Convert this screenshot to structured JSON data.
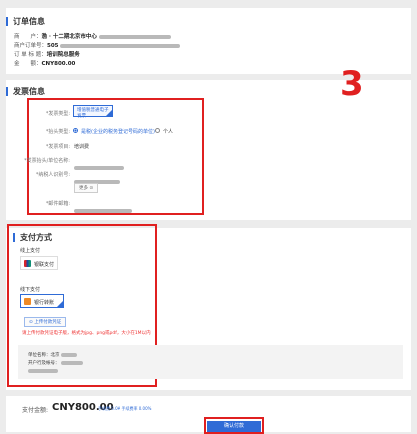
{
  "order": {
    "title": "订单信息",
    "rows": [
      {
        "label": "商　　户：",
        "value": "渤 · 十二期北京市中心"
      },
      {
        "label": "商户订单号：",
        "value": "505"
      },
      {
        "label": "订 单 标 题：",
        "value": "培训院总服务"
      },
      {
        "label": "金　　额：",
        "value": "CNY800.00"
      }
    ]
  },
  "annotation": "3",
  "invoice": {
    "title": "发票信息",
    "fields": {
      "type_label": "*发票类型:",
      "type_value": "增值税普通电子发票",
      "header_type_label": "*抬头类型:",
      "header_opt1": "是税(企业的税务登记号码的单位)",
      "header_opt2": "个人",
      "project_label": "*发票项目:",
      "project_value": "培训费",
      "name_label": "*发票抬头/单位名称:",
      "taxid_label": "*纳税人识别号:",
      "more_label": "更多 ⊙",
      "email_label": "*邮件邮箱:"
    }
  },
  "payment": {
    "title": "支付方式",
    "online_label": "线上支付",
    "online_option": "银联支付",
    "offline_label": "线下支付",
    "offline_option": "银行转账",
    "upload_label": "上传付款凭证",
    "upload_note": "请上传付款凭证电子版，格式为jpg、png或pdf，大小在1M以内",
    "bank_name_label": "单位名称：北京",
    "bank_account_label": "开户行及帐号："
  },
  "footer": {
    "amount_label": "支付金额:",
    "amount_value": "CNY800.00",
    "fee_note": "手续费 0.0¥  手续费率 0.00%",
    "confirm_label": "确认付款"
  },
  "colors": {
    "accent": "#2f6bd6",
    "highlight": "#e02020"
  }
}
